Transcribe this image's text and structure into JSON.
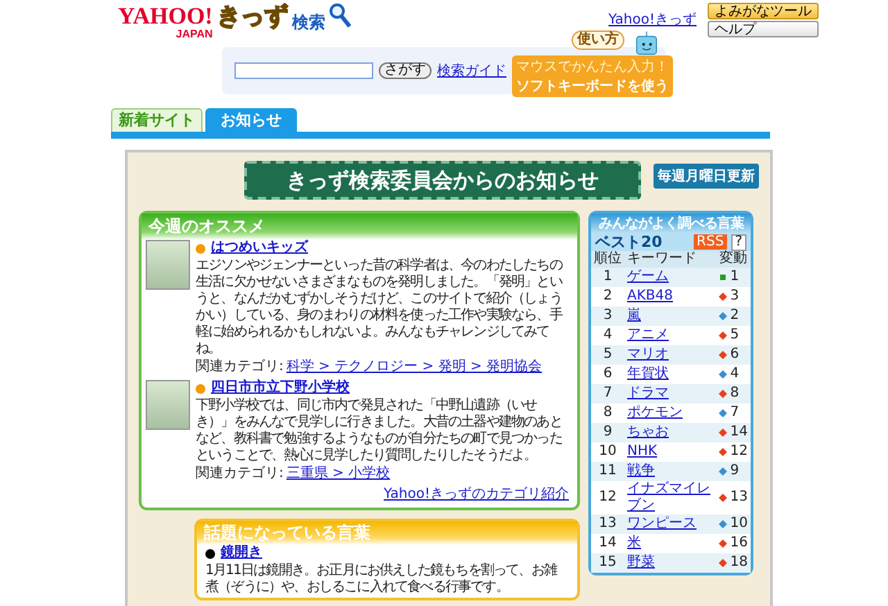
{
  "header": {
    "logo_yahoo": "YAHOO!",
    "logo_japan": "JAPAN",
    "logo_kids": "きっず",
    "logo_search": "検索",
    "kids_link": "Yahoo!きっず",
    "tool_buttons": [
      "よみがなツール",
      "ヘルプ"
    ]
  },
  "search": {
    "button": "さがす",
    "guide_link": "検索ガイド",
    "howto_bubble": "使い方",
    "keyboard_hint": "マウスでかんたん入力！",
    "keyboard_button": "ソフトキーボードを使う"
  },
  "tabs": [
    {
      "label": "新着サイト",
      "selected": false
    },
    {
      "label": "お知らせ",
      "selected": true
    }
  ],
  "notice": {
    "title": "きっず検索委員会からのお知らせ",
    "update_badge": "毎週月曜日更新"
  },
  "weekly": {
    "heading": "今週のオススメ",
    "items": [
      {
        "title": "はつめいキッズ",
        "text": "エジソンやジェンナーといった昔の科学者は、今のわたしたちの生活に欠かせないさまざまなものを発明しました。「発明」というと、なんだかむずかしそうだけど、このサイトで紹介（しょうかい）している、身のまわりの材料を使った工作や実験なら、手軽に始められるかもしれないよ。みんなもチャレンジしてみてね。",
        "category_label": "関連カテゴリ:",
        "category": "科学 > テクノロジー > 発明 > 発明協会"
      },
      {
        "title": "四日市市立下野小学校",
        "text": "下野小学校では、同じ市内で発見された「中野山遺跡（いせき）」をみんなで見学しに行きました。大昔の土器や建物のあとなど、教科書で勉強するようなものが自分たちの町で見つかったということで、熱心に見学したり質問したりしたそうだよ。",
        "category_label": "関連カテゴリ:",
        "category": "三重県 > 小学校"
      }
    ],
    "footer_link": "Yahoo!きっずのカテゴリ紹介"
  },
  "topics": {
    "heading": "話題になっている言葉",
    "items": [
      {
        "word": "鏡開き",
        "text": "1月11日は鏡開き。お正月にお供えした鏡もちを割って、お雑煮（ぞうに）や、おしるこに入れて食べる行事です。"
      }
    ]
  },
  "ranking": {
    "heading": "みんながよく調べる言葉",
    "subheading": "ベスト20",
    "rss": "RSS",
    "help": "?",
    "columns": [
      "順位",
      "キーワード",
      "変動"
    ],
    "rows": [
      {
        "rank": "1",
        "keyword": "ゲーム",
        "kind": "same",
        "change": "1"
      },
      {
        "rank": "2",
        "keyword": "AKB48",
        "kind": "up",
        "change": "3"
      },
      {
        "rank": "3",
        "keyword": "嵐",
        "kind": "down",
        "change": "2"
      },
      {
        "rank": "4",
        "keyword": "アニメ",
        "kind": "up",
        "change": "5"
      },
      {
        "rank": "5",
        "keyword": "マリオ",
        "kind": "up",
        "change": "6"
      },
      {
        "rank": "6",
        "keyword": "年賀状",
        "kind": "down",
        "change": "4"
      },
      {
        "rank": "7",
        "keyword": "ドラマ",
        "kind": "up",
        "change": "8"
      },
      {
        "rank": "8",
        "keyword": "ポケモン",
        "kind": "down",
        "change": "7"
      },
      {
        "rank": "9",
        "keyword": "ちゃお",
        "kind": "up",
        "change": "14"
      },
      {
        "rank": "10",
        "keyword": "NHK",
        "kind": "up",
        "change": "12"
      },
      {
        "rank": "11",
        "keyword": "戦争",
        "kind": "down",
        "change": "9"
      },
      {
        "rank": "12",
        "keyword": "イナズマイレブン",
        "kind": "up",
        "change": "13"
      },
      {
        "rank": "13",
        "keyword": "ワンピース",
        "kind": "down",
        "change": "10"
      },
      {
        "rank": "14",
        "keyword": "米",
        "kind": "up",
        "change": "16"
      },
      {
        "rank": "15",
        "keyword": "野菜",
        "kind": "up",
        "change": "18"
      }
    ]
  }
}
